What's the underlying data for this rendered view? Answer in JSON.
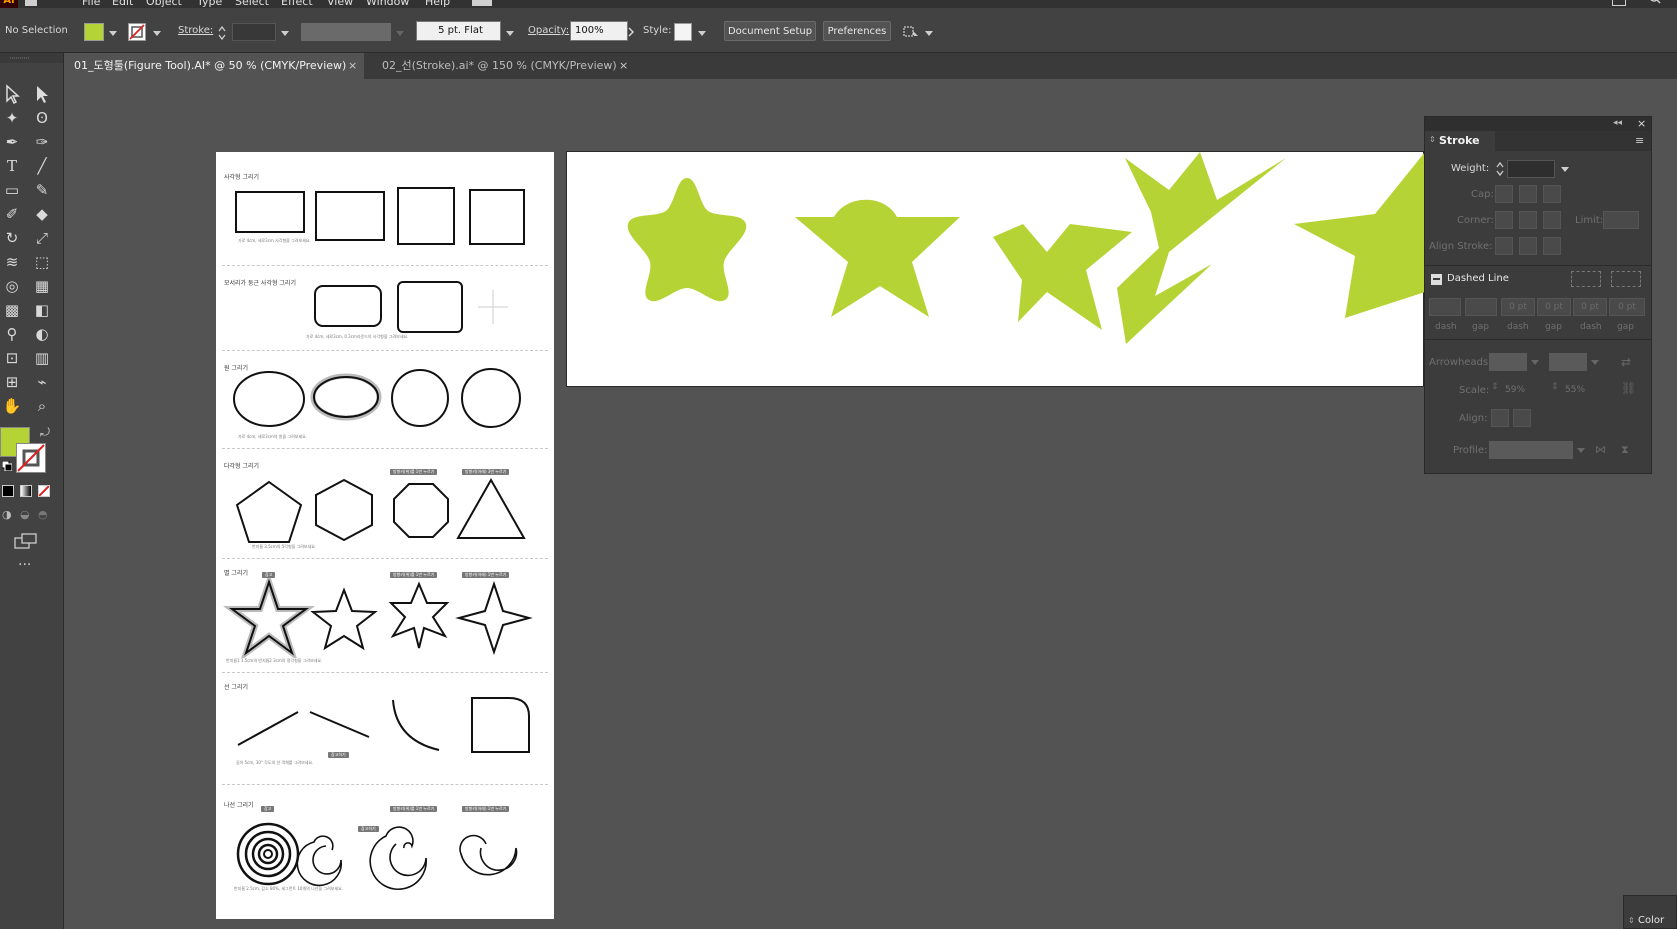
{
  "menubar": {
    "logo": "Ai",
    "items": [
      "File",
      "Edit",
      "Object",
      "Type",
      "Select",
      "Effect",
      "View",
      "Window",
      "Help"
    ]
  },
  "control": {
    "selection": "No Selection",
    "stroke_label": "Stroke:",
    "brush_value": "5 pt. Flat",
    "opacity_label": "Opacity:",
    "opacity_value": "100%",
    "style_label": "Style:",
    "document_setup": "Document Setup",
    "preferences": "Preferences",
    "fill_color": "#b5d334"
  },
  "tabs": [
    {
      "label": "01_도형툴(Figure Tool).AI* @ 50 % (CMYK/Preview)",
      "close": "×"
    },
    {
      "label": "02_선(Stroke).ai* @ 150 % (CMYK/Preview)",
      "close": "×"
    }
  ],
  "artboard1": {
    "sections": [
      {
        "title": "사각형 그리기",
        "caption": "가로 4cm, 세로3cm 사각형을 그려보세요."
      },
      {
        "title": "모서리가 둥근 사각형 그리기",
        "caption": "가로 4cm, 세로3cm, 0.3cm라운드의 사각형을 그려보세요."
      },
      {
        "title": "원 그리기",
        "caption": "가로 4cm, 세로3cm의 원을 그려보세요."
      },
      {
        "title": "다각형 그리기",
        "caption": "반지름 3.5cm의 5각형을 그려보세요.",
        "tags": [
          "방향키(위)를 1번 누르기",
          "방향키(아래) 3번 누르기"
        ]
      },
      {
        "title": "별 그리기",
        "caption": "반지름1 1.5cm의 반지름2 3cm의 정각형을 그려보세요.",
        "tags": [
          "참고",
          "방향키(위)를 1번 누르기",
          "방향키(아래) 1번 누르기"
        ]
      },
      {
        "title": "선 그리기",
        "caption": "길이 5cm, 30° 각도의 선 객체를 그려보세요.",
        "tags": [
          "참고하기"
        ]
      },
      {
        "title": "나선 그리기",
        "caption": "반지름 2.5cm, 감소 80%, 세그먼트 10개의 나선을 그려보세요.",
        "tags": [
          "참고",
          "참고하기",
          "방향키(위)를 1번 누르기",
          "방향키(아래) 1번 누르기"
        ]
      }
    ]
  },
  "artboard2": {
    "shapes": [
      "rounded-star",
      "puffy-star",
      "pinched-star",
      "fragmented-star",
      "partial-star"
    ],
    "fill": "#b5d334"
  },
  "stroke_panel": {
    "title": "Stroke",
    "weight": "Weight:",
    "cap": "Cap:",
    "corner": "Corner:",
    "limit": "Limit:",
    "align_stroke": "Align Stroke:",
    "dashed_line": "Dashed Line",
    "dash_values": [
      "0 pt",
      "0 pt",
      "0 pt",
      "0 pt"
    ],
    "dash_labels": [
      "dash",
      "gap",
      "dash",
      "gap",
      "dash",
      "gap"
    ],
    "arrowheads": "Arrowheads:",
    "scale": "Scale:",
    "scale_values": [
      "59%",
      "55%"
    ],
    "align": "Align:",
    "profile": "Profile:"
  },
  "color_panel": {
    "title": "Color"
  }
}
